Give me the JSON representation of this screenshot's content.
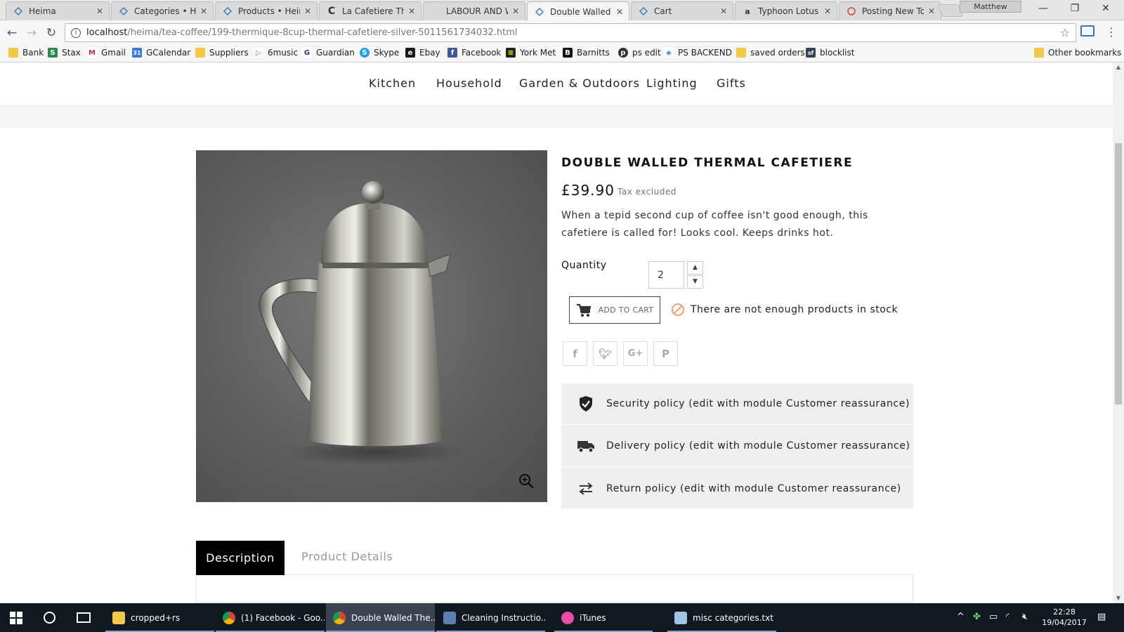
{
  "browser": {
    "tabs": [
      {
        "title": "Heima"
      },
      {
        "title": "Categories • Heima"
      },
      {
        "title": "Products • Heima"
      },
      {
        "title": "La Cafetiere Thermique"
      },
      {
        "title": "LABOUR AND WAIT"
      },
      {
        "title": "Double Walled Thermal"
      },
      {
        "title": "Cart"
      },
      {
        "title": "Typhoon Lotus Tea"
      },
      {
        "title": "Posting New Topic"
      }
    ],
    "profile_name": "Matthew",
    "url_host": "localhost",
    "url_path": "/heima/tea-coffee/199-thermique-8cup-thermal-cafetiere-silver-5011561734032.html",
    "bookmarks": [
      "Bank",
      "Stax",
      "Gmail",
      "GCalendar",
      "Suppliers",
      "6music",
      "Guardian",
      "Skype",
      "Ebay",
      "Facebook",
      "York Met",
      "Barnitts",
      "ps edit",
      "PS BACKEND",
      "saved orders",
      "blocklist"
    ],
    "other_bookmarks": "Other bookmarks"
  },
  "nav": {
    "categories": [
      "Kitchen",
      "Household",
      "Garden & Outdoors",
      "Lighting",
      "Gifts"
    ]
  },
  "product": {
    "title": "DOUBLE WALLED THERMAL CAFETIERE",
    "price": "£39.90",
    "tax_note": "Tax excluded",
    "description": "When a tepid second cup of coffee isn't good enough, this cafetiere is called for! Looks cool. Keeps drinks hot.",
    "quantity_label": "Quantity",
    "quantity_value": "2",
    "add_to_cart_label": "ADD TO CART",
    "stock_warning": "There are not enough products in stock"
  },
  "reassurance": [
    {
      "icon": "shield-check-icon",
      "text": "Security policy (edit with module Customer reassurance)"
    },
    {
      "icon": "truck-icon",
      "text": "Delivery policy (edit with module Customer reassurance)"
    },
    {
      "icon": "swap-arrows-icon",
      "text": "Return policy (edit with module Customer reassurance)"
    }
  ],
  "product_tabs": {
    "description": "Description",
    "details": "Product Details"
  },
  "taskbar": {
    "items": [
      {
        "label": "cropped+rs"
      },
      {
        "label": "(1) Facebook - Goo..."
      },
      {
        "label": "Double Walled The..."
      },
      {
        "label": "Cleaning Instructio..."
      },
      {
        "label": "iTunes"
      },
      {
        "label": "misc categories.txt ..."
      }
    ],
    "time": "22:28",
    "date": "19/04/2017"
  },
  "colors": {
    "tab_active_bg": "#000000",
    "warning": "#f39d72",
    "reassurance_bg": "#efefef"
  }
}
